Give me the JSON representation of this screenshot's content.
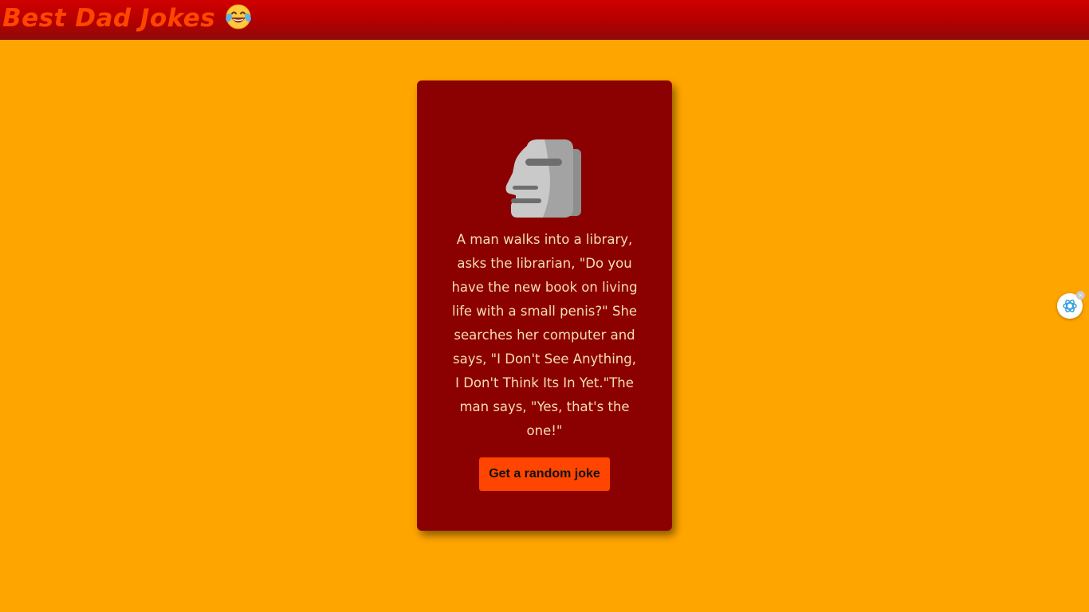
{
  "header": {
    "title": "Best Dad Jokes",
    "emoji_icon": "face-with-tears-of-joy-icon"
  },
  "card": {
    "illustration_icon": "moai-icon",
    "joke": "A man walks into a library, asks the librarian, \"Do you have the new book on living life with a small penis?\" She searches her computer and says, \"I Don't See Anything, I Don't Think Its In Yet.\"The man says, \"Yes, that's the one!\"",
    "button_label": "Get a random joke"
  },
  "widget": {
    "icon": "assistant-swirl-icon",
    "close_glyph": "×"
  },
  "colors": {
    "page_background": "#FFA500",
    "header_background": "#C00000",
    "title_color": "#FF4500",
    "card_background": "#8B0000",
    "joke_text_color": "#F5DEB3",
    "button_background": "#FF4500"
  }
}
